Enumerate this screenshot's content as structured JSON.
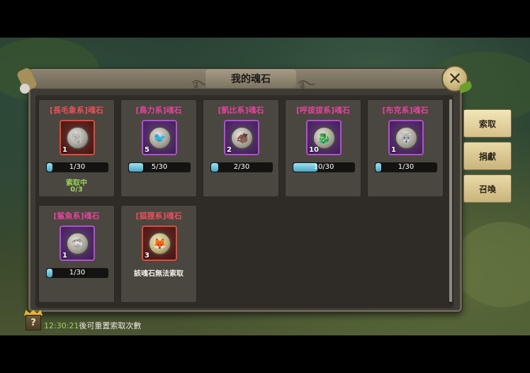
{
  "window": {
    "title": "我的魂石",
    "close_icon": "close-icon"
  },
  "side_buttons": [
    {
      "label": "索取",
      "active": true
    },
    {
      "label": "捐獻",
      "active": false
    },
    {
      "label": "召喚",
      "active": false
    }
  ],
  "cards": [
    {
      "name": "[長毛象系]魂石",
      "count": "1",
      "progress_label": "1/30",
      "progress": 0.033,
      "rarity": "red",
      "status_line1": "索取中",
      "status_line2": "0/3",
      "note": ""
    },
    {
      "name": "[鳥力系]魂石",
      "count": "5",
      "progress_label": "5/30",
      "progress": 0.167,
      "rarity": "purple",
      "status_line1": "",
      "status_line2": "",
      "note": ""
    },
    {
      "name": "[凱比系]魂石",
      "count": "2",
      "progress_label": "2/30",
      "progress": 0.067,
      "rarity": "purple",
      "status_line1": "",
      "status_line2": "",
      "note": ""
    },
    {
      "name": "[呼拔拔系]魂石",
      "count": "10",
      "progress_label": "10/30",
      "progress": 0.333,
      "rarity": "purple",
      "status_line1": "",
      "status_line2": "",
      "note": ""
    },
    {
      "name": "[布克系]魂石",
      "count": "1",
      "progress_label": "1/30",
      "progress": 0.033,
      "rarity": "purple",
      "status_line1": "",
      "status_line2": "",
      "note": ""
    },
    {
      "name": "[鯊魚系]魂石",
      "count": "1",
      "progress_label": "1/30",
      "progress": 0.033,
      "rarity": "purple",
      "status_line1": "",
      "status_line2": "",
      "note": ""
    },
    {
      "name": "[狐狸系]魂石",
      "count": "3",
      "progress_label": "",
      "progress": null,
      "rarity": "red",
      "status_line1": "",
      "status_line2": "",
      "note": "該魂石無法索取"
    }
  ],
  "footer": {
    "time": "12:30:21",
    "text": "後可重置索取次數",
    "help_icon": "question-icon"
  },
  "colors": {
    "accent_bar": "#4aa7c4",
    "name_purple": "#e0449a",
    "name_red": "#e8505a",
    "status_green": "#9bd45a"
  }
}
